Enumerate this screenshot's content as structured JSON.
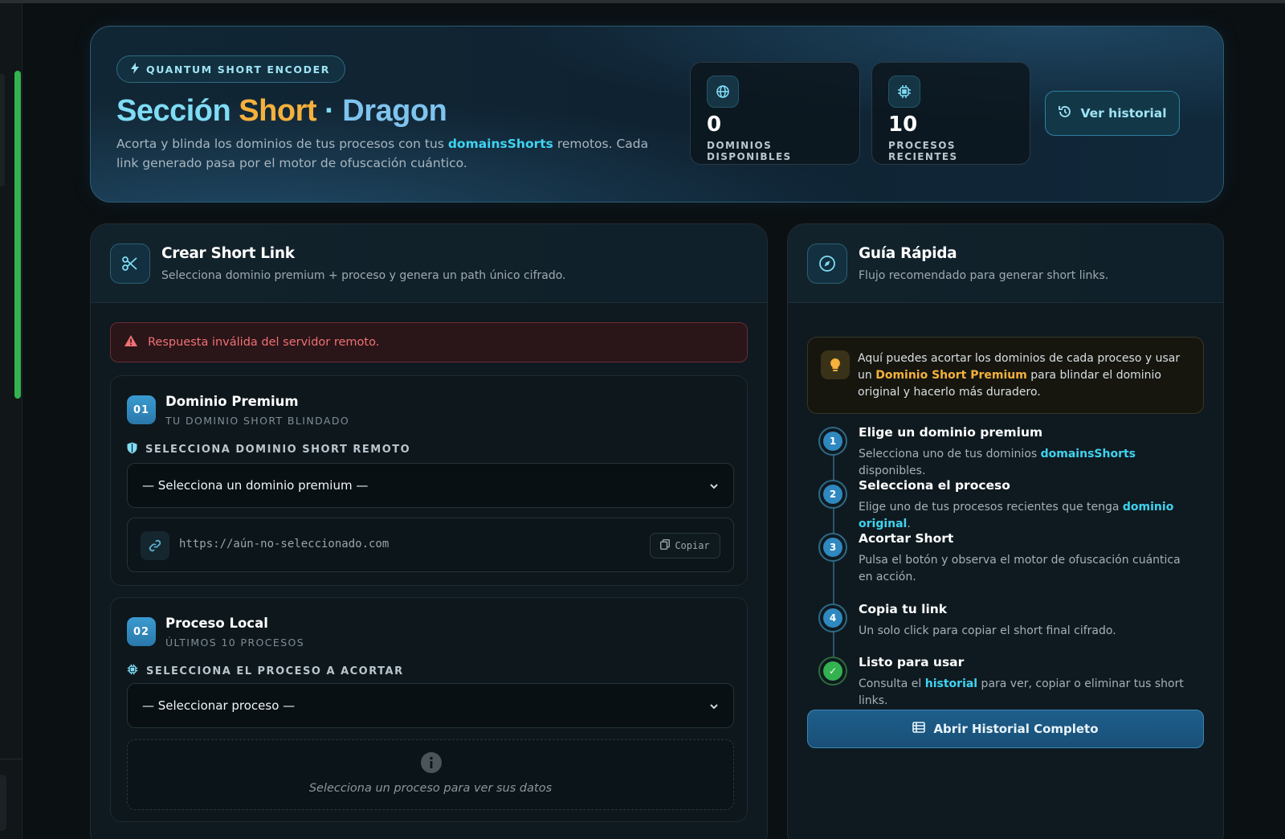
{
  "hero": {
    "badge": "QUANTUM SHORT ENCODER",
    "title_part1": "Sección",
    "title_part2": "Short",
    "title_sep": "·",
    "title_part3": "Dragon",
    "desc_pre": "Acorta y blinda los dominios de tus procesos con tus ",
    "desc_highlight": "domainsShorts",
    "desc_post": " remotos. Cada link generado pasa por el motor de ofuscación cuántico.",
    "stats": [
      {
        "value": "0",
        "label": "DOMINIOS DISPONIBLES",
        "icon": "globe-icon"
      },
      {
        "value": "10",
        "label": "PROCESOS RECIENTES",
        "icon": "chip-icon"
      }
    ],
    "history_button": "Ver historial"
  },
  "create": {
    "title": "Crear Short Link",
    "subtitle": "Selecciona dominio premium + proceso y genera un path único cifrado.",
    "alert": "Respuesta inválida del servidor remoto.",
    "step1": {
      "num": "01",
      "title": "Dominio Premium",
      "subtitle": "TU DOMINIO SHORT BLINDADO",
      "field_label": "SELECCIONA DOMINIO SHORT REMOTO",
      "select_value": "— Selecciona un dominio premium —",
      "url": "https://aún-no-seleccionado.com",
      "copy": "Copiar"
    },
    "step2": {
      "num": "02",
      "title": "Proceso Local",
      "subtitle": "ÚLTIMOS 10 PROCESOS",
      "field_label": "SELECCIONA EL PROCESO A ACORTAR",
      "select_value": "— Seleccionar proceso —",
      "empty_msg": "Selecciona un proceso para ver sus datos"
    }
  },
  "guide": {
    "title": "Guía Rápida",
    "subtitle": "Flujo recomendado para generar short links.",
    "tip_pre": "Aquí puedes acortar los dominios de cada proceso y usar un ",
    "tip_highlight": "Dominio Short Premium",
    "tip_post": " para blindar el dominio original y hacerlo más duradero.",
    "steps": [
      {
        "n": "1",
        "title": "Elige un dominio premium",
        "pre": "Selecciona uno de tus dominios ",
        "hl": "domainsShorts",
        "post": " disponibles."
      },
      {
        "n": "2",
        "title": "Selecciona el proceso",
        "pre": "Elige uno de tus procesos recientes que tenga ",
        "hl": "dominio original",
        "post": "."
      },
      {
        "n": "3",
        "title": "Acortar Short",
        "pre": "Pulsa el botón y observa el motor de ofuscación cuántica en acción.",
        "hl": "",
        "post": ""
      },
      {
        "n": "4",
        "title": "Copia tu link",
        "pre": "Un solo click para copiar el short final cifrado.",
        "hl": "",
        "post": ""
      },
      {
        "n": "✓",
        "title": "Listo para usar",
        "pre": "Consulta el ",
        "hl": "historial",
        "post": " para ver, copiar o eliminar tus short links."
      }
    ],
    "open_button": "Abrir Historial Completo"
  },
  "colors": {
    "accent_cyan": "#3fd3f0",
    "accent_amber": "#f5b13c",
    "error": "#f07171",
    "success": "#33b24f"
  }
}
